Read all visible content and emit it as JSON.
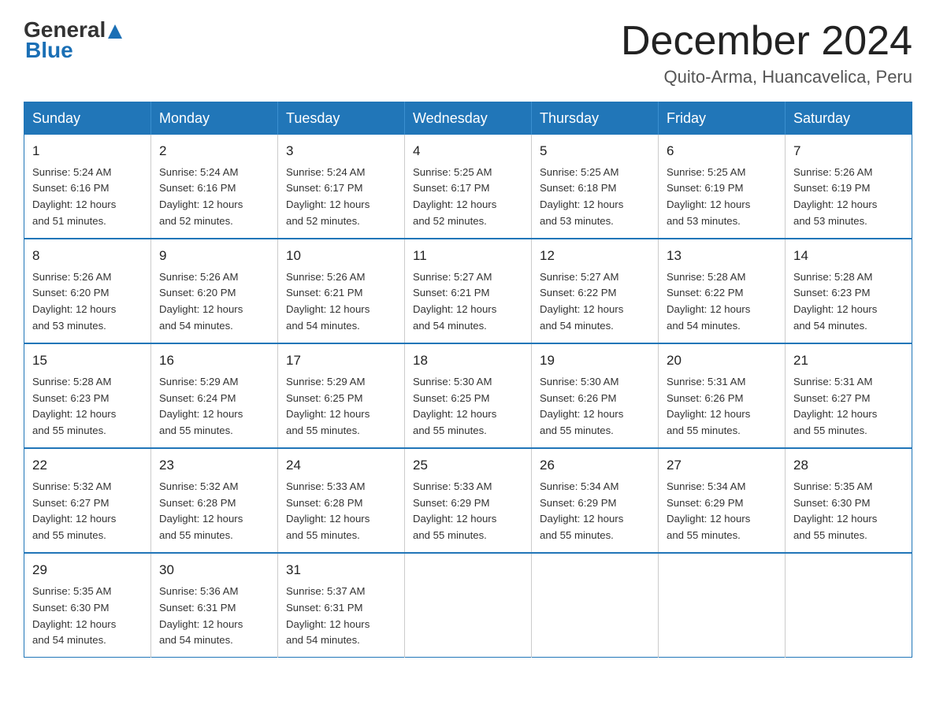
{
  "logo": {
    "general": "General",
    "arrow": "▲",
    "blue": "Blue"
  },
  "header": {
    "month_title": "December 2024",
    "location": "Quito-Arma, Huancavelica, Peru"
  },
  "days_of_week": [
    "Sunday",
    "Monday",
    "Tuesday",
    "Wednesday",
    "Thursday",
    "Friday",
    "Saturday"
  ],
  "weeks": [
    [
      {
        "day": "1",
        "sunrise": "5:24 AM",
        "sunset": "6:16 PM",
        "daylight": "12 hours and 51 minutes."
      },
      {
        "day": "2",
        "sunrise": "5:24 AM",
        "sunset": "6:16 PM",
        "daylight": "12 hours and 52 minutes."
      },
      {
        "day": "3",
        "sunrise": "5:24 AM",
        "sunset": "6:17 PM",
        "daylight": "12 hours and 52 minutes."
      },
      {
        "day": "4",
        "sunrise": "5:25 AM",
        "sunset": "6:17 PM",
        "daylight": "12 hours and 52 minutes."
      },
      {
        "day": "5",
        "sunrise": "5:25 AM",
        "sunset": "6:18 PM",
        "daylight": "12 hours and 53 minutes."
      },
      {
        "day": "6",
        "sunrise": "5:25 AM",
        "sunset": "6:19 PM",
        "daylight": "12 hours and 53 minutes."
      },
      {
        "day": "7",
        "sunrise": "5:26 AM",
        "sunset": "6:19 PM",
        "daylight": "12 hours and 53 minutes."
      }
    ],
    [
      {
        "day": "8",
        "sunrise": "5:26 AM",
        "sunset": "6:20 PM",
        "daylight": "12 hours and 53 minutes."
      },
      {
        "day": "9",
        "sunrise": "5:26 AM",
        "sunset": "6:20 PM",
        "daylight": "12 hours and 54 minutes."
      },
      {
        "day": "10",
        "sunrise": "5:26 AM",
        "sunset": "6:21 PM",
        "daylight": "12 hours and 54 minutes."
      },
      {
        "day": "11",
        "sunrise": "5:27 AM",
        "sunset": "6:21 PM",
        "daylight": "12 hours and 54 minutes."
      },
      {
        "day": "12",
        "sunrise": "5:27 AM",
        "sunset": "6:22 PM",
        "daylight": "12 hours and 54 minutes."
      },
      {
        "day": "13",
        "sunrise": "5:28 AM",
        "sunset": "6:22 PM",
        "daylight": "12 hours and 54 minutes."
      },
      {
        "day": "14",
        "sunrise": "5:28 AM",
        "sunset": "6:23 PM",
        "daylight": "12 hours and 54 minutes."
      }
    ],
    [
      {
        "day": "15",
        "sunrise": "5:28 AM",
        "sunset": "6:23 PM",
        "daylight": "12 hours and 55 minutes."
      },
      {
        "day": "16",
        "sunrise": "5:29 AM",
        "sunset": "6:24 PM",
        "daylight": "12 hours and 55 minutes."
      },
      {
        "day": "17",
        "sunrise": "5:29 AM",
        "sunset": "6:25 PM",
        "daylight": "12 hours and 55 minutes."
      },
      {
        "day": "18",
        "sunrise": "5:30 AM",
        "sunset": "6:25 PM",
        "daylight": "12 hours and 55 minutes."
      },
      {
        "day": "19",
        "sunrise": "5:30 AM",
        "sunset": "6:26 PM",
        "daylight": "12 hours and 55 minutes."
      },
      {
        "day": "20",
        "sunrise": "5:31 AM",
        "sunset": "6:26 PM",
        "daylight": "12 hours and 55 minutes."
      },
      {
        "day": "21",
        "sunrise": "5:31 AM",
        "sunset": "6:27 PM",
        "daylight": "12 hours and 55 minutes."
      }
    ],
    [
      {
        "day": "22",
        "sunrise": "5:32 AM",
        "sunset": "6:27 PM",
        "daylight": "12 hours and 55 minutes."
      },
      {
        "day": "23",
        "sunrise": "5:32 AM",
        "sunset": "6:28 PM",
        "daylight": "12 hours and 55 minutes."
      },
      {
        "day": "24",
        "sunrise": "5:33 AM",
        "sunset": "6:28 PM",
        "daylight": "12 hours and 55 minutes."
      },
      {
        "day": "25",
        "sunrise": "5:33 AM",
        "sunset": "6:29 PM",
        "daylight": "12 hours and 55 minutes."
      },
      {
        "day": "26",
        "sunrise": "5:34 AM",
        "sunset": "6:29 PM",
        "daylight": "12 hours and 55 minutes."
      },
      {
        "day": "27",
        "sunrise": "5:34 AM",
        "sunset": "6:29 PM",
        "daylight": "12 hours and 55 minutes."
      },
      {
        "day": "28",
        "sunrise": "5:35 AM",
        "sunset": "6:30 PM",
        "daylight": "12 hours and 55 minutes."
      }
    ],
    [
      {
        "day": "29",
        "sunrise": "5:35 AM",
        "sunset": "6:30 PM",
        "daylight": "12 hours and 54 minutes."
      },
      {
        "day": "30",
        "sunrise": "5:36 AM",
        "sunset": "6:31 PM",
        "daylight": "12 hours and 54 minutes."
      },
      {
        "day": "31",
        "sunrise": "5:37 AM",
        "sunset": "6:31 PM",
        "daylight": "12 hours and 54 minutes."
      },
      null,
      null,
      null,
      null
    ]
  ],
  "labels": {
    "sunrise": "Sunrise:",
    "sunset": "Sunset:",
    "daylight": "Daylight:"
  }
}
